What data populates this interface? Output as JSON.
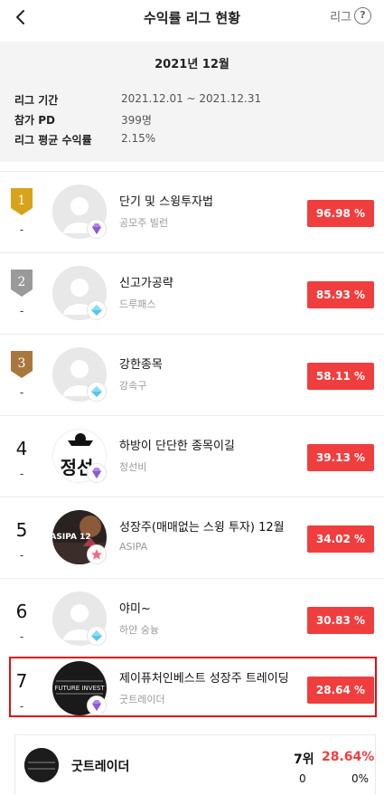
{
  "header": {
    "title": "수익률 리그 현황",
    "help_label": "리그",
    "help_symbol": "?"
  },
  "info": {
    "month": "2021년 12월",
    "rows": [
      {
        "label": "리그 기간",
        "value": "2021.12.01 ~ 2021.12.31"
      },
      {
        "label": "참가 PD",
        "value": "399명"
      },
      {
        "label": "리그 평균 수익률",
        "value": "2.15%"
      }
    ]
  },
  "ranking": [
    {
      "rank": "1",
      "change": "-",
      "name": "단기 및 스윙투자법",
      "sub": "공모주 빌런",
      "pct": "96.98 %",
      "badge": "gold",
      "grade": "purple-diamond"
    },
    {
      "rank": "2",
      "change": "-",
      "name": "신고가공략",
      "sub": "드루패스",
      "pct": "85.93 %",
      "badge": "silver",
      "grade": "blue-diamond"
    },
    {
      "rank": "3",
      "change": "-",
      "name": "강한종목",
      "sub": "강속구",
      "pct": "58.11 %",
      "badge": "bronze",
      "grade": "blue-diamond"
    },
    {
      "rank": "4",
      "change": "-",
      "name": "하방이 단단한 종목이길",
      "sub": "정선비",
      "pct": "39.13 %",
      "grade": "purple-diamond",
      "avatar_text": "정선"
    },
    {
      "rank": "5",
      "change": "-",
      "name": "성장주(매매없는 스윙 투자) 12월",
      "sub": "ASIPA",
      "pct": "34.02 %",
      "grade": "pink-star",
      "avatar_text": "ASIPA 12"
    },
    {
      "rank": "6",
      "change": "-",
      "name": "야미~",
      "sub": "하얀 숭늉",
      "pct": "30.83 %",
      "grade": "blue-diamond"
    },
    {
      "rank": "7",
      "change": "-",
      "name": "제이퓨처인베스트 성장주 트레이딩",
      "sub": "굿트레이더",
      "pct": "28.64 %",
      "grade": "purple-diamond",
      "avatar_text": "FUTURE INVEST"
    }
  ],
  "my_summary": {
    "name": "굿트레이더",
    "rank": "7위",
    "pct": "28.64%",
    "value_left": "0",
    "value_right": "0%"
  },
  "colors": {
    "accent": "#f03e3e",
    "gold": "#d9a21b",
    "silver": "#9a9a9a",
    "bronze": "#a8773e",
    "highlight_border": "#e01010"
  }
}
